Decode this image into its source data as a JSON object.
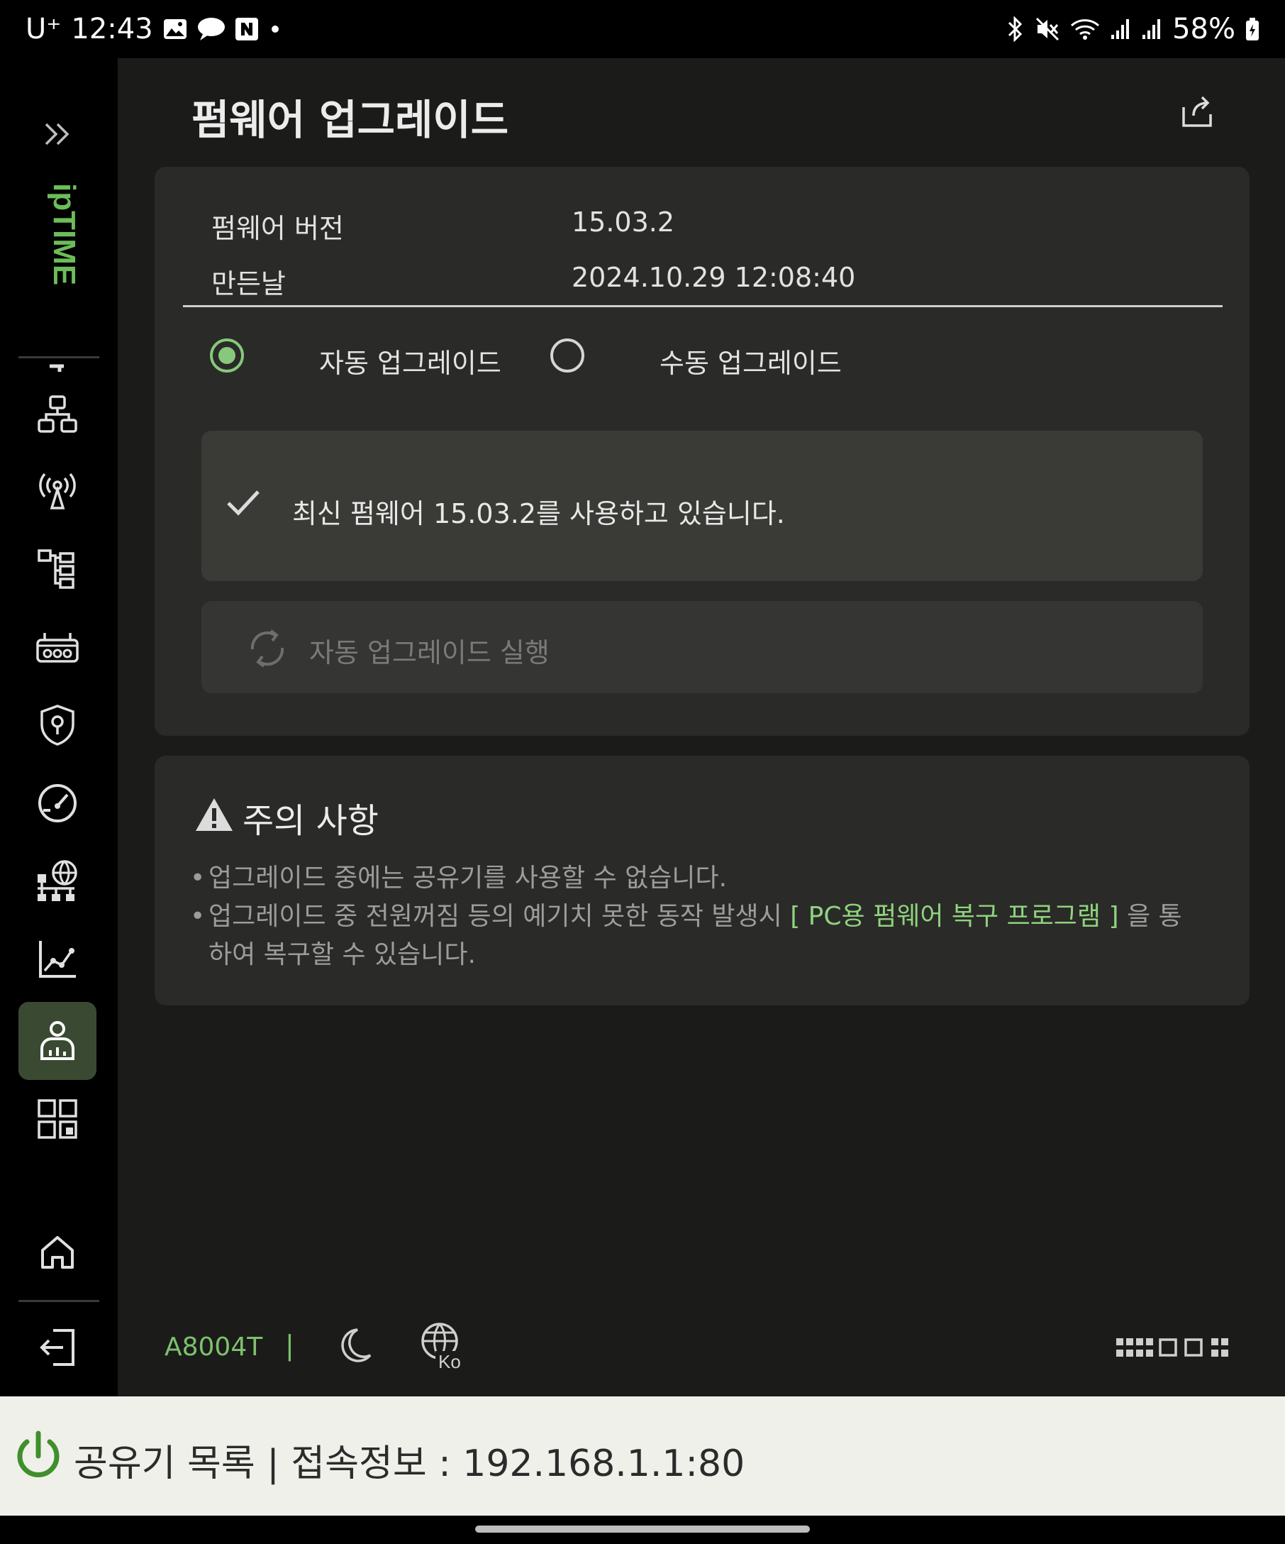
{
  "status_bar": {
    "carrier": "U⁺",
    "time": "12:43",
    "battery": "58%"
  },
  "sidebar": {
    "logo_text": "ipTIME",
    "items": [
      {
        "icon": "expand-icon"
      },
      {
        "icon": "network-icon"
      },
      {
        "icon": "wireless-icon"
      },
      {
        "icon": "topology-icon"
      },
      {
        "icon": "router-icon"
      },
      {
        "icon": "security-icon"
      },
      {
        "icon": "speed-icon"
      },
      {
        "icon": "network-settings-icon"
      },
      {
        "icon": "chart-icon"
      },
      {
        "icon": "admin-icon",
        "active": true
      },
      {
        "icon": "apps-icon"
      },
      {
        "icon": "home-icon"
      },
      {
        "icon": "logout-icon"
      }
    ]
  },
  "page": {
    "title": "펌웨어 업그레이드"
  },
  "firmware": {
    "version_label": "펌웨어 버전",
    "version_value": "15.03.2",
    "date_label": "만든날",
    "date_value": "2024.10.29 12:08:40"
  },
  "upgrade_mode": {
    "auto_label": "자동 업그레이드",
    "manual_label": "수동 업그레이드",
    "selected": "auto"
  },
  "status": {
    "message": "최신 펌웨어 15.03.2를 사용하고 있습니다."
  },
  "run_button": {
    "label": "자동 업그레이드 실행"
  },
  "caution": {
    "title": "주의 사항",
    "item1": "업그레이드 중에는 공유기를 사용할 수 없습니다.",
    "item2_pre": "업그레이드 중 전원꺼짐 등의 예기치 못한 동작 발생시 ",
    "item2_link": "[ PC용 펌웨어 복구 프로그램 ]",
    "item2_post": " 을 통",
    "item2_line2": "하여 복구할 수  있습니다."
  },
  "footer": {
    "model": "A8004T",
    "separator": "|",
    "lang_code": "Ko"
  },
  "bottom_bar": {
    "text": "공유기 목록  | 접속정보 : 192.168.1.1:80"
  },
  "colors": {
    "accent": "#86c97a",
    "background": "#1b1c19",
    "card": "#2a2a28"
  }
}
